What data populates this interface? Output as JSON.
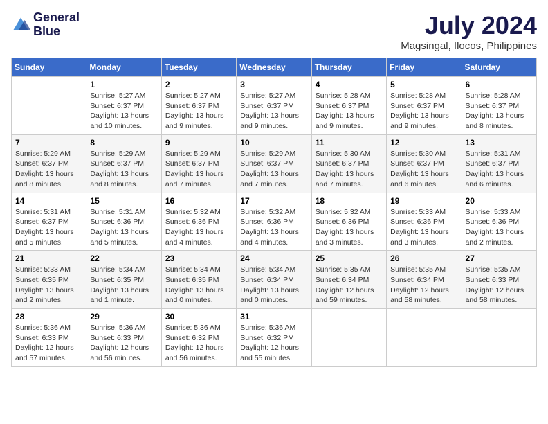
{
  "header": {
    "logo_line1": "General",
    "logo_line2": "Blue",
    "month": "July 2024",
    "location": "Magsingal, Ilocos, Philippines"
  },
  "weekdays": [
    "Sunday",
    "Monday",
    "Tuesday",
    "Wednesday",
    "Thursday",
    "Friday",
    "Saturday"
  ],
  "weeks": [
    [
      {
        "day": "",
        "sunrise": "",
        "sunset": "",
        "daylight": ""
      },
      {
        "day": "1",
        "sunrise": "Sunrise: 5:27 AM",
        "sunset": "Sunset: 6:37 PM",
        "daylight": "Daylight: 13 hours and 10 minutes."
      },
      {
        "day": "2",
        "sunrise": "Sunrise: 5:27 AM",
        "sunset": "Sunset: 6:37 PM",
        "daylight": "Daylight: 13 hours and 9 minutes."
      },
      {
        "day": "3",
        "sunrise": "Sunrise: 5:27 AM",
        "sunset": "Sunset: 6:37 PM",
        "daylight": "Daylight: 13 hours and 9 minutes."
      },
      {
        "day": "4",
        "sunrise": "Sunrise: 5:28 AM",
        "sunset": "Sunset: 6:37 PM",
        "daylight": "Daylight: 13 hours and 9 minutes."
      },
      {
        "day": "5",
        "sunrise": "Sunrise: 5:28 AM",
        "sunset": "Sunset: 6:37 PM",
        "daylight": "Daylight: 13 hours and 9 minutes."
      },
      {
        "day": "6",
        "sunrise": "Sunrise: 5:28 AM",
        "sunset": "Sunset: 6:37 PM",
        "daylight": "Daylight: 13 hours and 8 minutes."
      }
    ],
    [
      {
        "day": "7",
        "sunrise": "Sunrise: 5:29 AM",
        "sunset": "Sunset: 6:37 PM",
        "daylight": "Daylight: 13 hours and 8 minutes."
      },
      {
        "day": "8",
        "sunrise": "Sunrise: 5:29 AM",
        "sunset": "Sunset: 6:37 PM",
        "daylight": "Daylight: 13 hours and 8 minutes."
      },
      {
        "day": "9",
        "sunrise": "Sunrise: 5:29 AM",
        "sunset": "Sunset: 6:37 PM",
        "daylight": "Daylight: 13 hours and 7 minutes."
      },
      {
        "day": "10",
        "sunrise": "Sunrise: 5:29 AM",
        "sunset": "Sunset: 6:37 PM",
        "daylight": "Daylight: 13 hours and 7 minutes."
      },
      {
        "day": "11",
        "sunrise": "Sunrise: 5:30 AM",
        "sunset": "Sunset: 6:37 PM",
        "daylight": "Daylight: 13 hours and 7 minutes."
      },
      {
        "day": "12",
        "sunrise": "Sunrise: 5:30 AM",
        "sunset": "Sunset: 6:37 PM",
        "daylight": "Daylight: 13 hours and 6 minutes."
      },
      {
        "day": "13",
        "sunrise": "Sunrise: 5:31 AM",
        "sunset": "Sunset: 6:37 PM",
        "daylight": "Daylight: 13 hours and 6 minutes."
      }
    ],
    [
      {
        "day": "14",
        "sunrise": "Sunrise: 5:31 AM",
        "sunset": "Sunset: 6:37 PM",
        "daylight": "Daylight: 13 hours and 5 minutes."
      },
      {
        "day": "15",
        "sunrise": "Sunrise: 5:31 AM",
        "sunset": "Sunset: 6:36 PM",
        "daylight": "Daylight: 13 hours and 5 minutes."
      },
      {
        "day": "16",
        "sunrise": "Sunrise: 5:32 AM",
        "sunset": "Sunset: 6:36 PM",
        "daylight": "Daylight: 13 hours and 4 minutes."
      },
      {
        "day": "17",
        "sunrise": "Sunrise: 5:32 AM",
        "sunset": "Sunset: 6:36 PM",
        "daylight": "Daylight: 13 hours and 4 minutes."
      },
      {
        "day": "18",
        "sunrise": "Sunrise: 5:32 AM",
        "sunset": "Sunset: 6:36 PM",
        "daylight": "Daylight: 13 hours and 3 minutes."
      },
      {
        "day": "19",
        "sunrise": "Sunrise: 5:33 AM",
        "sunset": "Sunset: 6:36 PM",
        "daylight": "Daylight: 13 hours and 3 minutes."
      },
      {
        "day": "20",
        "sunrise": "Sunrise: 5:33 AM",
        "sunset": "Sunset: 6:36 PM",
        "daylight": "Daylight: 13 hours and 2 minutes."
      }
    ],
    [
      {
        "day": "21",
        "sunrise": "Sunrise: 5:33 AM",
        "sunset": "Sunset: 6:35 PM",
        "daylight": "Daylight: 13 hours and 2 minutes."
      },
      {
        "day": "22",
        "sunrise": "Sunrise: 5:34 AM",
        "sunset": "Sunset: 6:35 PM",
        "daylight": "Daylight: 13 hours and 1 minute."
      },
      {
        "day": "23",
        "sunrise": "Sunrise: 5:34 AM",
        "sunset": "Sunset: 6:35 PM",
        "daylight": "Daylight: 13 hours and 0 minutes."
      },
      {
        "day": "24",
        "sunrise": "Sunrise: 5:34 AM",
        "sunset": "Sunset: 6:34 PM",
        "daylight": "Daylight: 13 hours and 0 minutes."
      },
      {
        "day": "25",
        "sunrise": "Sunrise: 5:35 AM",
        "sunset": "Sunset: 6:34 PM",
        "daylight": "Daylight: 12 hours and 59 minutes."
      },
      {
        "day": "26",
        "sunrise": "Sunrise: 5:35 AM",
        "sunset": "Sunset: 6:34 PM",
        "daylight": "Daylight: 12 hours and 58 minutes."
      },
      {
        "day": "27",
        "sunrise": "Sunrise: 5:35 AM",
        "sunset": "Sunset: 6:33 PM",
        "daylight": "Daylight: 12 hours and 58 minutes."
      }
    ],
    [
      {
        "day": "28",
        "sunrise": "Sunrise: 5:36 AM",
        "sunset": "Sunset: 6:33 PM",
        "daylight": "Daylight: 12 hours and 57 minutes."
      },
      {
        "day": "29",
        "sunrise": "Sunrise: 5:36 AM",
        "sunset": "Sunset: 6:33 PM",
        "daylight": "Daylight: 12 hours and 56 minutes."
      },
      {
        "day": "30",
        "sunrise": "Sunrise: 5:36 AM",
        "sunset": "Sunset: 6:32 PM",
        "daylight": "Daylight: 12 hours and 56 minutes."
      },
      {
        "day": "31",
        "sunrise": "Sunrise: 5:36 AM",
        "sunset": "Sunset: 6:32 PM",
        "daylight": "Daylight: 12 hours and 55 minutes."
      },
      {
        "day": "",
        "sunrise": "",
        "sunset": "",
        "daylight": ""
      },
      {
        "day": "",
        "sunrise": "",
        "sunset": "",
        "daylight": ""
      },
      {
        "day": "",
        "sunrise": "",
        "sunset": "",
        "daylight": ""
      }
    ]
  ]
}
